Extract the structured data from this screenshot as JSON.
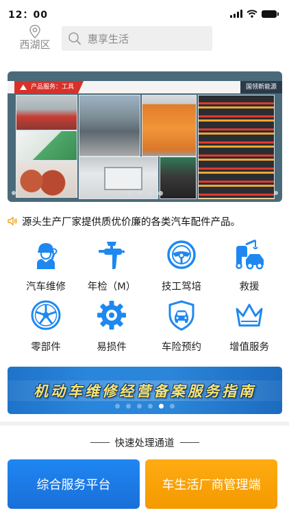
{
  "status_bar": {
    "time": "12：00"
  },
  "header": {
    "location": "西湖区",
    "search_placeholder": "惠享生活"
  },
  "banner": {
    "tag": "产品服务：工具",
    "brand": "国领新能源"
  },
  "notice": {
    "text": "源头生产厂家提供质优价廉的各类汽车配件产品。"
  },
  "services": [
    {
      "label": "汽车维修",
      "icon": "mechanic-icon"
    },
    {
      "label": "年检（M）",
      "icon": "spray-gun-icon"
    },
    {
      "label": "技工驾培",
      "icon": "steering-wheel-icon"
    },
    {
      "label": "救援",
      "icon": "tow-truck-icon"
    },
    {
      "label": "零部件",
      "icon": "wheel-rim-icon"
    },
    {
      "label": "易损件",
      "icon": "gear-icon"
    },
    {
      "label": "车险预约",
      "icon": "car-shield-icon"
    },
    {
      "label": "增值服务",
      "icon": "crown-icon"
    }
  ],
  "promo_banner": {
    "text": "机动车维修经营备案服务指南"
  },
  "quick_access": {
    "title": "快速处理通道",
    "buttons": [
      "综合服务平台",
      "车生活厂商管理端"
    ]
  },
  "colors": {
    "accent_blue": "#1f86f2",
    "accent_orange": "#ffab12",
    "icon_blue": "#1e88f0"
  }
}
